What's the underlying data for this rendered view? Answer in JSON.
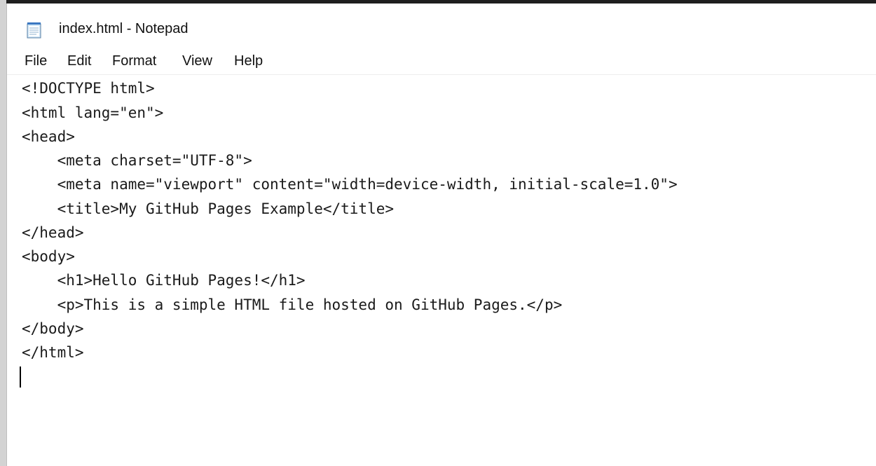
{
  "window": {
    "title": "index.html - Notepad",
    "icon": "notepad-icon"
  },
  "menu": {
    "items": [
      {
        "label": "File"
      },
      {
        "label": "Edit"
      },
      {
        "label": "Format"
      },
      {
        "label": "View"
      },
      {
        "label": "Help"
      }
    ]
  },
  "editor": {
    "lines": [
      "<!DOCTYPE html>",
      "<html lang=\"en\">",
      "<head>",
      "    <meta charset=\"UTF-8\">",
      "    <meta name=\"viewport\" content=\"width=device-width, initial-scale=1.0\">",
      "    <title>My GitHub Pages Example</title>",
      "</head>",
      "<body>",
      "    <h1>Hello GitHub Pages!</h1>",
      "    <p>This is a simple HTML file hosted on GitHub Pages.</p>",
      "</body>",
      "</html>"
    ]
  }
}
